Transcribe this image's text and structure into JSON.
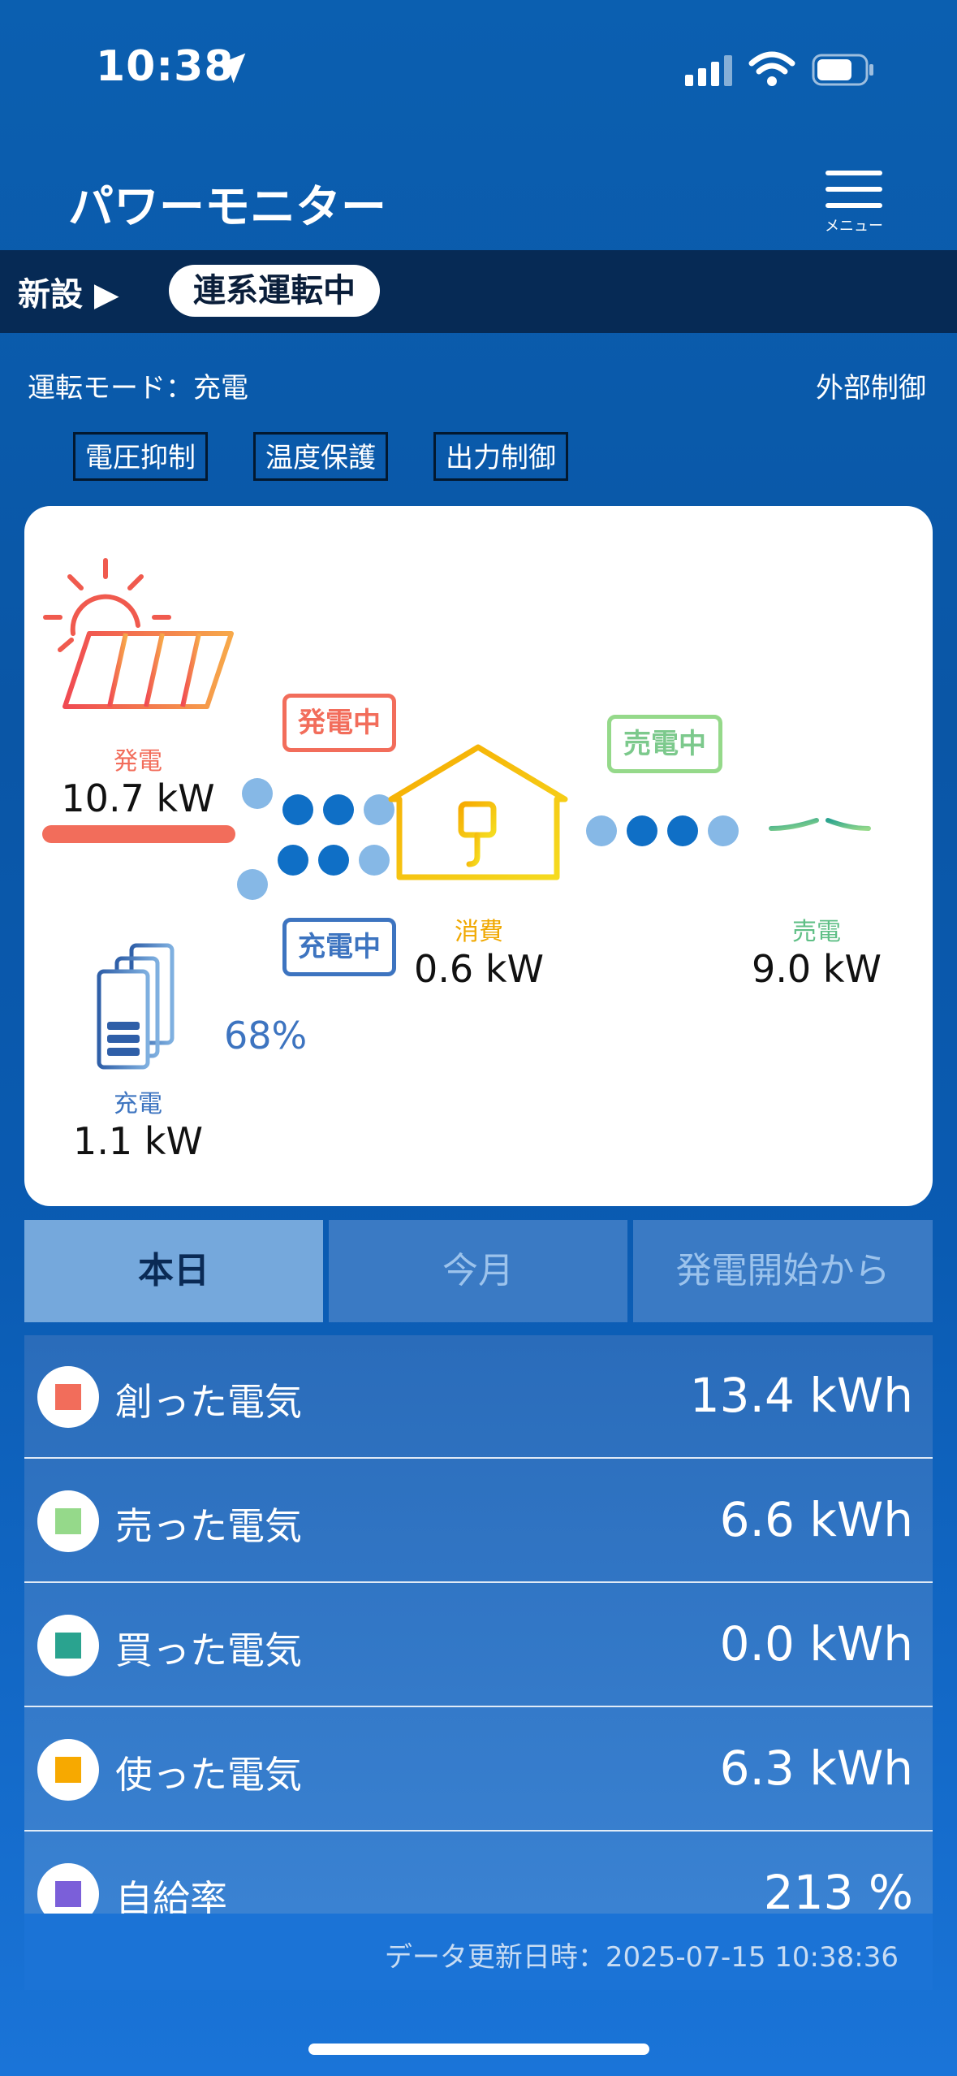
{
  "status_bar": {
    "time": "10:38"
  },
  "header": {
    "title": "パワーモニター",
    "menu_label": "メニュー"
  },
  "strip": {
    "new_label": "新設 ▶",
    "state": "連系運転中"
  },
  "op": {
    "mode": "運転モード：充電",
    "external": "外部制御",
    "tags": [
      "電圧抑制",
      "温度保護",
      "出力制御"
    ]
  },
  "flow": {
    "solar": {
      "label": "発電",
      "value": "10.7 kW",
      "status": "発電中",
      "color": "#f26d5b"
    },
    "battery": {
      "label": "充電",
      "value": "1.1 kW",
      "percent": "68%",
      "status": "充電中",
      "color": "#3d74c0"
    },
    "house": {
      "label": "消費",
      "value": "0.6 kW",
      "color": "#f6b400"
    },
    "grid": {
      "label": "売電",
      "value": "9.0 kW",
      "status": "売電中",
      "color": "#5fbf86"
    }
  },
  "tabs": {
    "today": "本日",
    "month": "今月",
    "since": "発電開始から",
    "active": "本日"
  },
  "rows": [
    {
      "label": "創った電気",
      "value": "13.4 kWh",
      "color": "#f26d5b"
    },
    {
      "label": "売った電気",
      "value": "6.6 kWh",
      "color": "#95d98a"
    },
    {
      "label": "買った電気",
      "value": "0.0 kWh",
      "color": "#2aa38f"
    },
    {
      "label": "使った電気",
      "value": "6.3 kWh",
      "color": "#f7a900"
    },
    {
      "label": "自給率",
      "value": "213 %",
      "color": "#7b5fd9"
    }
  ],
  "updated": "データ更新日時：2025-07-15 10:38:36"
}
